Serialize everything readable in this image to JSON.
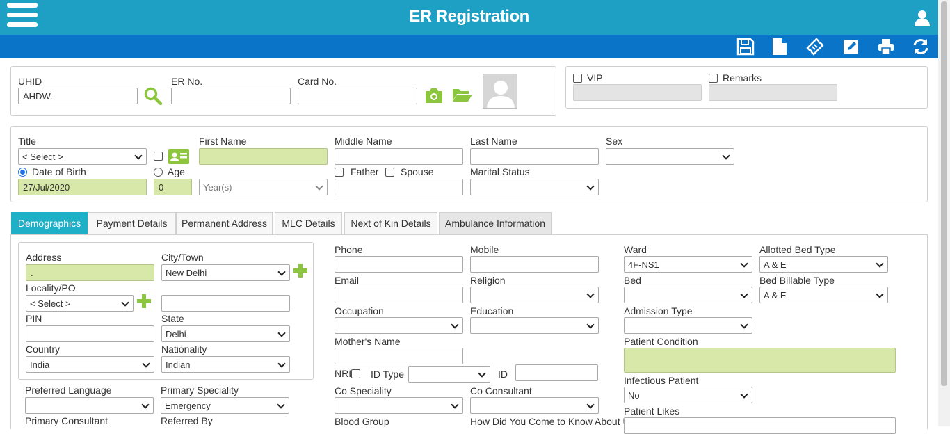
{
  "header": {
    "title": "ER Registration"
  },
  "toolbar": [
    "save-icon",
    "new-document-icon",
    "ticket-icon",
    "edit-icon",
    "print-icon",
    "refresh-icon"
  ],
  "colors": {
    "header": "#1e9fc4",
    "toolbar": "#0a74c9",
    "required_field": "#d8e8a8",
    "active_tab": "#1eb0c6",
    "accent_icon": "#8cc63f"
  },
  "top": {
    "uhid_label": "UHID",
    "uhid_value": "AHDW.",
    "er_label": "ER No.",
    "er_value": "",
    "card_label": "Card No.",
    "card_value": "",
    "vip_label": "VIP",
    "remarks_label": "Remarks"
  },
  "patient": {
    "title_label": "Title",
    "title_value": "< Select >",
    "first_name_label": "First Name",
    "middle_name_label": "Middle Name",
    "last_name_label": "Last Name",
    "sex_label": "Sex",
    "sex_value": "",
    "dob_label": "Date of Birth",
    "dob_value": "27/Jul/2020",
    "age_label": "Age",
    "age_value": "0",
    "age_unit": "Year(s)",
    "father_label": "Father",
    "spouse_label": "Spouse",
    "marital_label": "Marital Status"
  },
  "tabs": [
    {
      "label": "Demographics",
      "active": true
    },
    {
      "label": "Payment Details"
    },
    {
      "label": "Permanent Address"
    },
    {
      "label": "MLC Details"
    },
    {
      "label": "Next of Kin Details"
    },
    {
      "label": "Ambulance Information"
    }
  ],
  "address": {
    "address_label": "Address",
    "address_value": ".",
    "city_label": "City/Town",
    "city_value": "New Delhi",
    "locality_label": "Locality/PO",
    "locality_value": "< Select >",
    "pin_label": "PIN",
    "state_label": "State",
    "state_value": "Delhi",
    "country_label": "Country",
    "country_value": "India",
    "nationality_label": "Nationality",
    "nationality_value": "Indian"
  },
  "lower_left": {
    "pref_lang_label": "Preferred Language",
    "primary_spec_label": "Primary Speciality",
    "primary_spec_value": "Emergency",
    "primary_cons_label": "Primary Consultant",
    "referred_label": "Referred By"
  },
  "middle": {
    "phone_label": "Phone",
    "mobile_label": "Mobile",
    "email_label": "Email",
    "religion_label": "Religion",
    "occupation_label": "Occupation",
    "education_label": "Education",
    "mother_label": "Mother's Name",
    "nri_label": "NRI",
    "idtype_label": "ID Type",
    "id_label": "ID",
    "cospec_label": "Co Speciality",
    "cocons_label": "Co Consultant",
    "blood_label": "Blood Group",
    "know_label": "How Did You Come to Know About Us"
  },
  "right": {
    "ward_label": "Ward",
    "ward_value": "4F-NS1",
    "allotted_label": "Allotted Bed Type",
    "allotted_value": "A & E",
    "bed_label": "Bed",
    "billable_label": "Bed Billable Type",
    "billable_value": "A & E",
    "admission_label": "Admission Type",
    "condition_label": "Patient Condition",
    "infectious_label": "Infectious Patient",
    "infectious_value": "No",
    "likes_label": "Patient Likes"
  }
}
